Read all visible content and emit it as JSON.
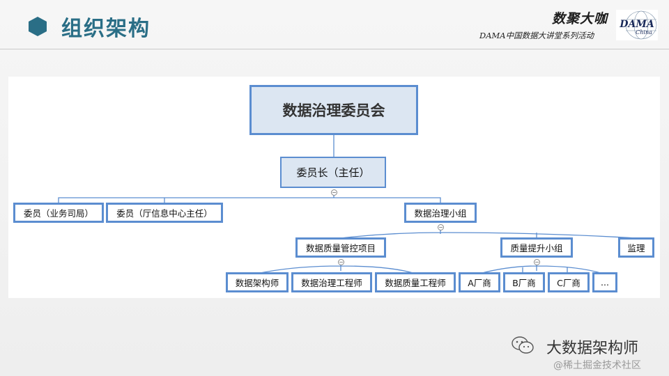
{
  "header": {
    "title": "组织架构",
    "brand": "数聚大咖",
    "subtitle": "DAMA中国数据大讲堂系列活动",
    "logo_text": "DAMA",
    "logo_subtext": "China"
  },
  "org_chart": {
    "root": "数据治理委员会",
    "chair": "委员长（主任）",
    "members": [
      "委员（业务司局）",
      "委员（厅信息中心主任）"
    ],
    "group": "数据治理小组",
    "subunits": [
      "数据质量管控项目",
      "质量提升小组",
      "监理"
    ],
    "project_roles": [
      "数据架构师",
      "数据治理工程师",
      "数据质量工程师"
    ],
    "vendors": [
      "A厂商",
      "B厂商",
      "C厂商",
      "..."
    ],
    "collapse_symbol": "−"
  },
  "watermark": {
    "account": "大数据架构师",
    "community": "@稀土掘金技术社区"
  },
  "colors": {
    "title": "#2a6e86",
    "node_border": "#5b8dd0",
    "node_fill": "#dce6f2",
    "connector": "#5b8dd0"
  }
}
